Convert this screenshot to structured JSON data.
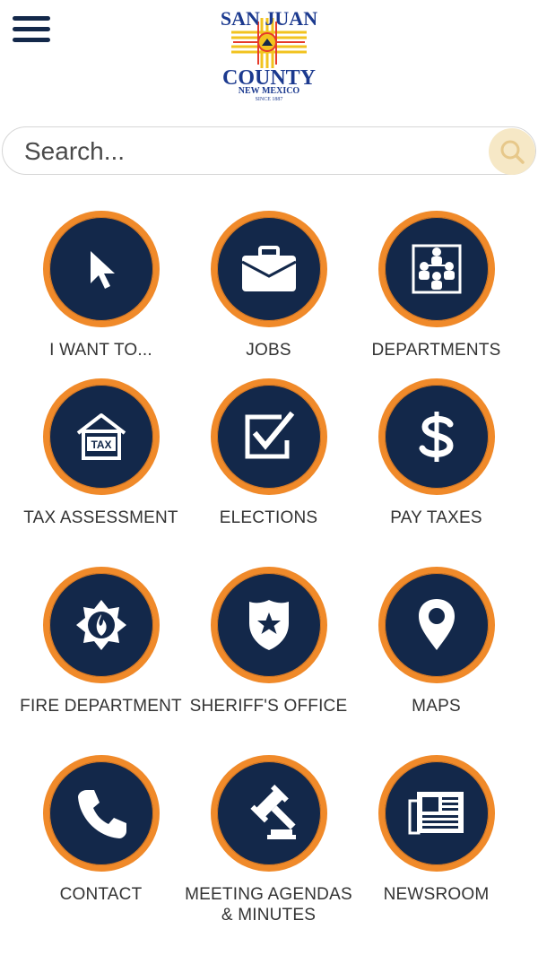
{
  "search": {
    "placeholder": "Search..."
  },
  "logo": {
    "line1": "SAN JUAN",
    "line2": "COUNTY",
    "line3": "NEW MEXICO",
    "line4": "SINCE 1887"
  },
  "tiles": [
    {
      "label": "I WANT TO...",
      "icon": "cursor-icon"
    },
    {
      "label": "JOBS",
      "icon": "briefcase-icon"
    },
    {
      "label": "DEPARTMENTS",
      "icon": "org-chart-icon"
    },
    {
      "label": "TAX ASSESSMENT",
      "icon": "tax-house-icon",
      "badge": "TAX"
    },
    {
      "label": "ELECTIONS",
      "icon": "checkbox-icon"
    },
    {
      "label": "PAY TAXES",
      "icon": "dollar-icon"
    },
    {
      "label": "FIRE DEPARTMENT",
      "icon": "fire-emblem-icon"
    },
    {
      "label": "SHERIFF'S OFFICE",
      "icon": "sheriff-badge-icon"
    },
    {
      "label": "MAPS",
      "icon": "map-pin-icon"
    },
    {
      "label": "CONTACT",
      "icon": "phone-icon"
    },
    {
      "label": "MEETING AGENDAS & MINUTES",
      "icon": "gavel-icon"
    },
    {
      "label": "NEWSROOM",
      "icon": "newspaper-icon"
    }
  ],
  "colors": {
    "navy": "#13284a",
    "orange": "#f08a2a",
    "searchButton": "#f6e8c6"
  }
}
